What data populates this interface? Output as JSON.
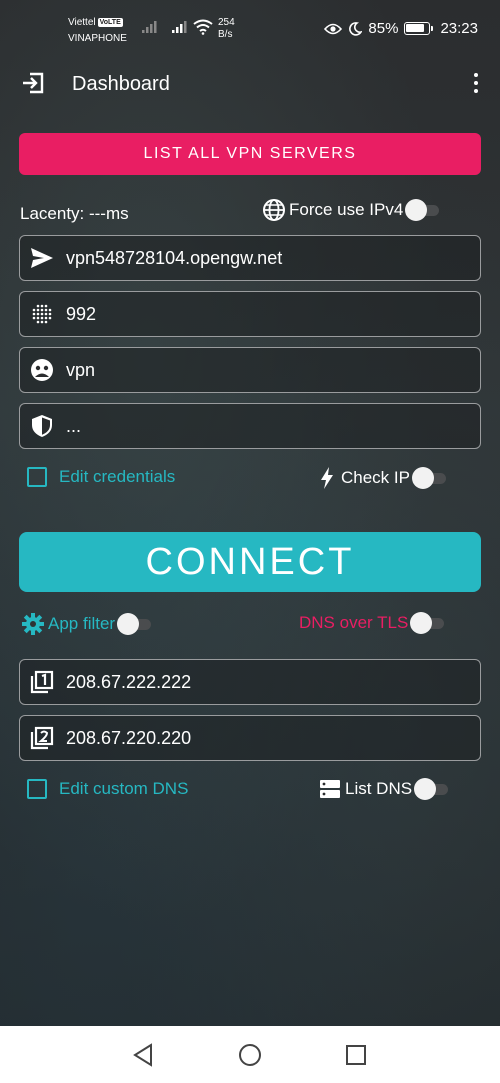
{
  "status_bar": {
    "carrier1": "Viettel",
    "volte": "VoLTE",
    "carrier2": "VINAPHONE",
    "net_speed": "254",
    "net_unit": "B/s",
    "battery": "85%",
    "battery_level": 0.85,
    "time": "23:23"
  },
  "app_bar": {
    "title": "Dashboard"
  },
  "list_servers_label": "LIST ALL VPN SERVERS",
  "latency_label": "Lacenty: ---ms",
  "force_ipv4_label": "Force use IPv4",
  "fields": {
    "server": "vpn548728104.opengw.net",
    "port": "992",
    "username": "vpn",
    "password": "..."
  },
  "edit_credentials_label": "Edit credentials",
  "check_ip_label": "Check IP",
  "connect_label": "CONNECT",
  "app_filter_label": "App filter",
  "dns_over_tls_label": "DNS over TLS",
  "dns": {
    "primary": "208.67.222.222",
    "secondary": "208.67.220.220"
  },
  "edit_custom_dns_label": "Edit custom DNS",
  "list_dns_label": "List DNS",
  "colors": {
    "accent_pink": "#e91e63",
    "accent_teal": "#26b8c2"
  }
}
